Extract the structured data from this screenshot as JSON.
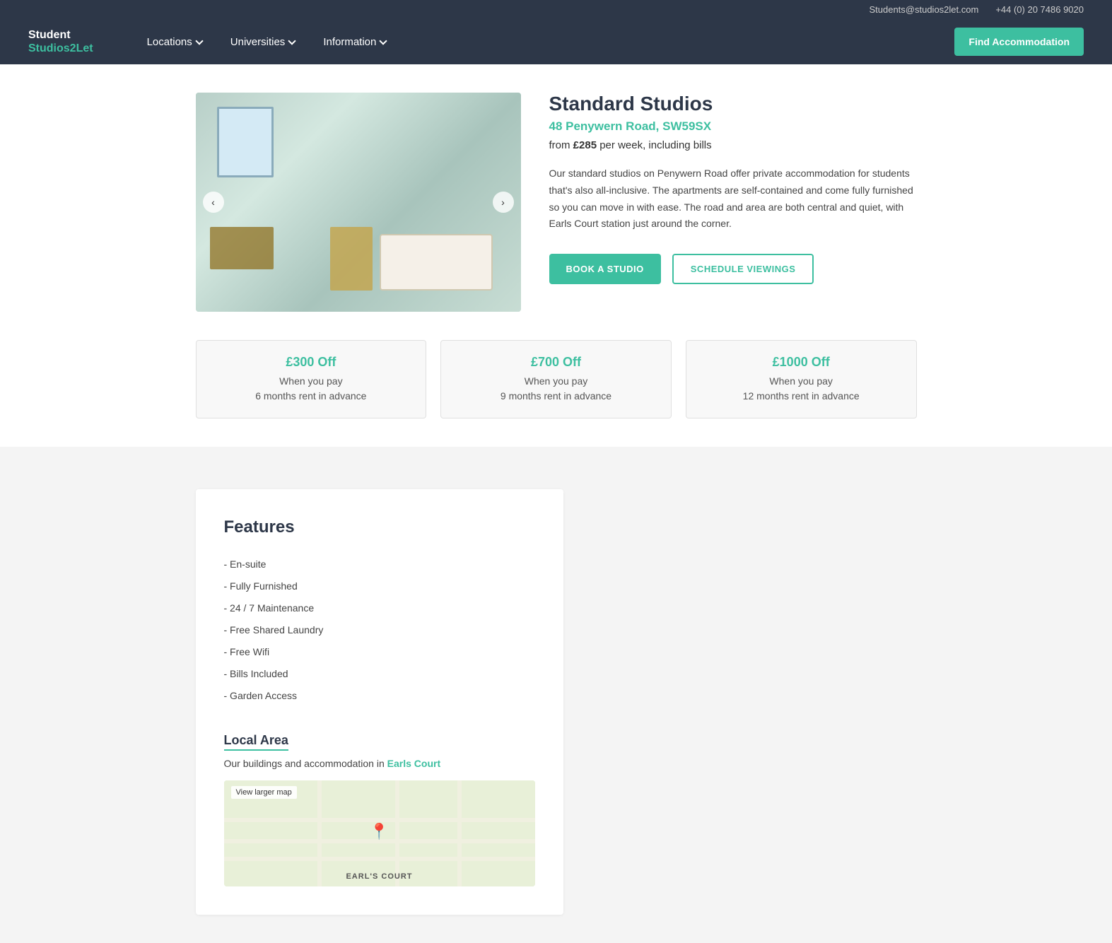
{
  "header": {
    "email": "Students@studios2let.com",
    "phone": "+44 (0) 20 7486 9020",
    "logo_line1": "Student",
    "logo_line2": "Studios2Let",
    "nav": [
      {
        "label": "Locations",
        "has_dropdown": true
      },
      {
        "label": "Universities",
        "has_dropdown": true
      },
      {
        "label": "Information",
        "has_dropdown": true
      }
    ],
    "cta_button": "Find Accommodation"
  },
  "property": {
    "title": "Standard Studios",
    "address": "48 Penywern Road, SW59SX",
    "price_prefix": "from",
    "price": "£285",
    "price_suffix": "per week, including bills",
    "description": "Our standard studios on Penywern Road offer private accommodation for students that's also all-inclusive. The apartments are self-contained and come fully furnished so you can move in with ease. The road and area are both central and quiet, with Earls Court station just around the corner.",
    "btn_book": "BOOK A STUDIO",
    "btn_schedule": "SCHEDULE VIEWINGS"
  },
  "discounts": [
    {
      "amount": "£300 Off",
      "line1": "When you pay",
      "line2": "6 months rent in advance"
    },
    {
      "amount": "£700 Off",
      "line1": "When you pay",
      "line2": "9 months rent in advance"
    },
    {
      "amount": "£1000 Off",
      "line1": "When you pay",
      "line2": "12 months rent in advance"
    }
  ],
  "features": {
    "title": "Features",
    "items": [
      "- En-suite",
      "- Fully Furnished",
      "- 24 / 7 Maintenance",
      "- Free Shared Laundry",
      "- Free Wifi",
      "- Bills Included",
      "- Garden Access"
    ],
    "local_area_title": "Local Area",
    "local_area_text": "Our buildings and accommodation in",
    "local_area_link": "Earls Court",
    "map_view_larger": "View larger map",
    "map_label": "EARL'S COURT"
  }
}
